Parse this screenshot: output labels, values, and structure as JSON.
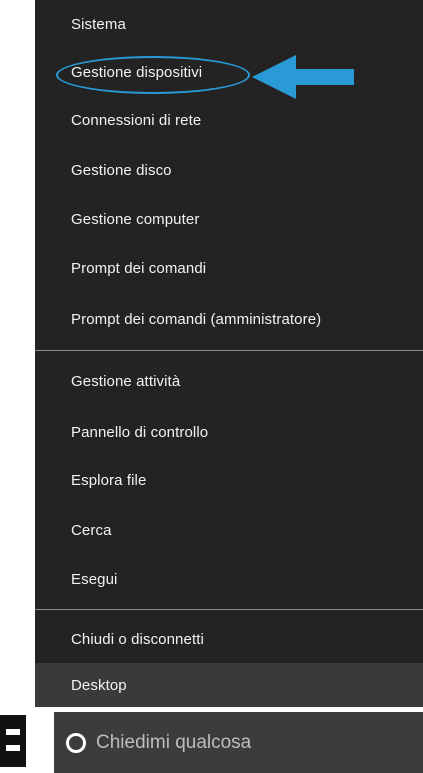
{
  "menu": {
    "items": [
      {
        "label": "Sistema"
      },
      {
        "label": "Gestione dispositivi"
      },
      {
        "label": "Connessioni di rete"
      },
      {
        "label": "Gestione disco"
      },
      {
        "label": "Gestione computer"
      },
      {
        "label": "Prompt dei comandi"
      },
      {
        "label": "Prompt dei comandi (amministratore)"
      },
      {
        "label": "Gestione attività"
      },
      {
        "label": "Pannello di controllo"
      },
      {
        "label": "Esplora file"
      },
      {
        "label": "Cerca"
      },
      {
        "label": "Esegui"
      },
      {
        "label": "Chiudi o disconnetti"
      },
      {
        "label": "Desktop"
      }
    ],
    "highlighted_item": "Gestione dispositivi",
    "selected_item": "Desktop"
  },
  "taskbar": {
    "search": {
      "placeholder": "Chiedimi qualcosa",
      "icon": "cortana-ring-icon"
    },
    "start_icon": "windows-start-icon"
  },
  "colors": {
    "menu_background": "#232323",
    "menu_text": "#f2f2f2",
    "selected_background": "#3a3a3a",
    "separator": "#8a8a8a",
    "annotation_accent": "#2a9ad6",
    "search_background": "#3c3c3c",
    "search_placeholder": "#bdbdbd"
  }
}
